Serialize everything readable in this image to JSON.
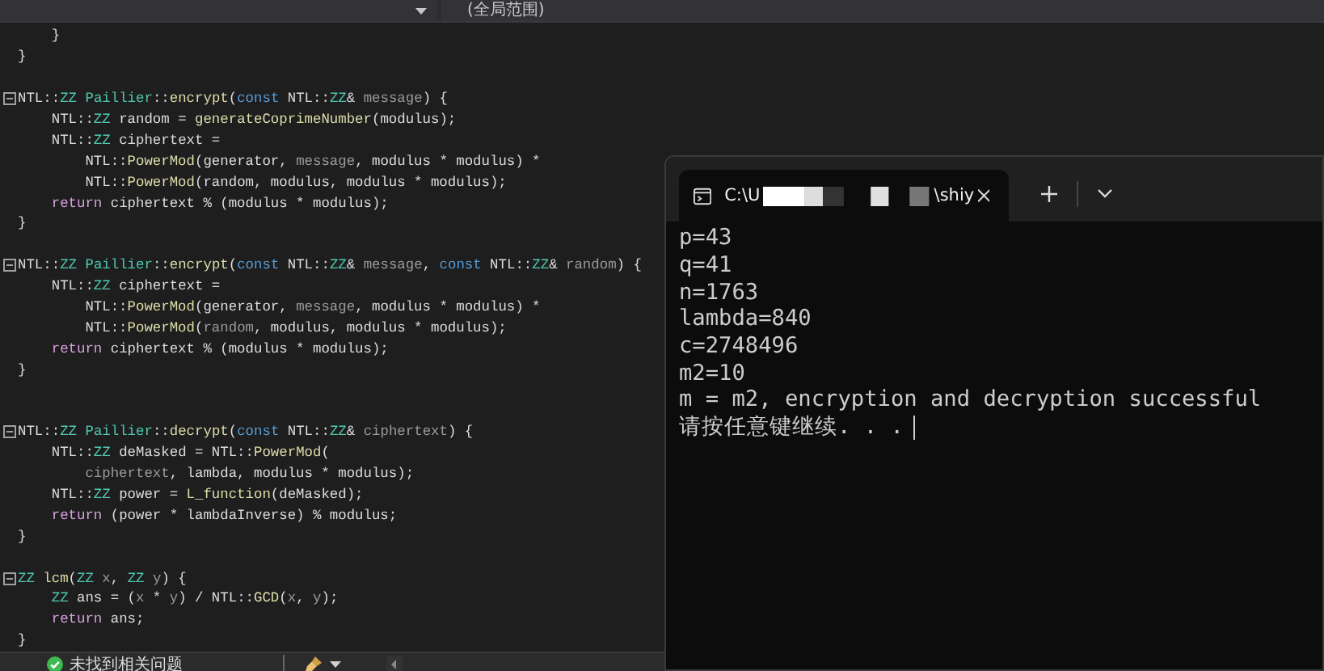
{
  "editor": {
    "scope_dropdown": {
      "value": "(全局范围)"
    },
    "lines": [
      {
        "kind": "code",
        "foldable": false,
        "segments": [
          {
            "kind": "plain",
            "text": "    }"
          }
        ]
      },
      {
        "kind": "code",
        "foldable": false,
        "segments": [
          {
            "kind": "plain",
            "text": "}"
          }
        ]
      },
      {
        "kind": "blank"
      },
      {
        "kind": "code",
        "foldable": true,
        "segments": [
          {
            "kind": "plain",
            "text": "NTL::"
          },
          {
            "kind": "type",
            "text": "ZZ"
          },
          {
            "kind": "type",
            "text": " Paillier"
          },
          {
            "kind": "plain",
            "text": "::"
          },
          {
            "kind": "func",
            "text": "encrypt"
          },
          {
            "kind": "plain",
            "text": "("
          },
          {
            "kind": "keyword",
            "text": "const"
          },
          {
            "kind": "plain",
            "text": " NTL::"
          },
          {
            "kind": "type",
            "text": "ZZ"
          },
          {
            "kind": "plain",
            "text": "& "
          },
          {
            "kind": "param",
            "text": "message"
          },
          {
            "kind": "plain",
            "text": ") {"
          }
        ]
      },
      {
        "kind": "code",
        "foldable": false,
        "segments": [
          {
            "kind": "plain",
            "text": "    NTL::"
          },
          {
            "kind": "type",
            "text": "ZZ"
          },
          {
            "kind": "plain",
            "text": " random = "
          },
          {
            "kind": "func",
            "text": "generateCoprimeNumber"
          },
          {
            "kind": "plain",
            "text": "(modulus);"
          }
        ]
      },
      {
        "kind": "code",
        "foldable": false,
        "segments": [
          {
            "kind": "plain",
            "text": "    NTL::"
          },
          {
            "kind": "type",
            "text": "ZZ"
          },
          {
            "kind": "plain",
            "text": " ciphertext ="
          }
        ]
      },
      {
        "kind": "code",
        "foldable": false,
        "segments": [
          {
            "kind": "plain",
            "text": "        NTL::"
          },
          {
            "kind": "func",
            "text": "PowerMod"
          },
          {
            "kind": "plain",
            "text": "(generator, "
          },
          {
            "kind": "param",
            "text": "message"
          },
          {
            "kind": "plain",
            "text": ", modulus * modulus) *"
          }
        ]
      },
      {
        "kind": "code",
        "foldable": false,
        "segments": [
          {
            "kind": "plain",
            "text": "        NTL::"
          },
          {
            "kind": "func",
            "text": "PowerMod"
          },
          {
            "kind": "plain",
            "text": "(random, modulus, modulus * modulus);"
          }
        ]
      },
      {
        "kind": "code",
        "foldable": false,
        "segments": [
          {
            "kind": "return",
            "text": "    return"
          },
          {
            "kind": "plain",
            "text": " ciphertext % (modulus * modulus);"
          }
        ]
      },
      {
        "kind": "code",
        "foldable": false,
        "segments": [
          {
            "kind": "plain",
            "text": "}"
          }
        ]
      },
      {
        "kind": "blank"
      },
      {
        "kind": "code",
        "foldable": true,
        "segments": [
          {
            "kind": "plain",
            "text": "NTL::"
          },
          {
            "kind": "type",
            "text": "ZZ"
          },
          {
            "kind": "type",
            "text": " Paillier"
          },
          {
            "kind": "plain",
            "text": "::"
          },
          {
            "kind": "func",
            "text": "encrypt"
          },
          {
            "kind": "plain",
            "text": "("
          },
          {
            "kind": "keyword",
            "text": "const"
          },
          {
            "kind": "plain",
            "text": " NTL::"
          },
          {
            "kind": "type",
            "text": "ZZ"
          },
          {
            "kind": "plain",
            "text": "& "
          },
          {
            "kind": "param",
            "text": "message"
          },
          {
            "kind": "plain",
            "text": ", "
          },
          {
            "kind": "keyword",
            "text": "const"
          },
          {
            "kind": "plain",
            "text": " NTL::"
          },
          {
            "kind": "type",
            "text": "ZZ"
          },
          {
            "kind": "plain",
            "text": "& "
          },
          {
            "kind": "param",
            "text": "random"
          },
          {
            "kind": "plain",
            "text": ") {"
          }
        ]
      },
      {
        "kind": "code",
        "foldable": false,
        "segments": [
          {
            "kind": "plain",
            "text": "    NTL::"
          },
          {
            "kind": "type",
            "text": "ZZ"
          },
          {
            "kind": "plain",
            "text": " ciphertext ="
          }
        ]
      },
      {
        "kind": "code",
        "foldable": false,
        "segments": [
          {
            "kind": "plain",
            "text": "        NTL::"
          },
          {
            "kind": "func",
            "text": "PowerMod"
          },
          {
            "kind": "plain",
            "text": "(generator, "
          },
          {
            "kind": "param",
            "text": "message"
          },
          {
            "kind": "plain",
            "text": ", modulus * modulus) *"
          }
        ]
      },
      {
        "kind": "code",
        "foldable": false,
        "segments": [
          {
            "kind": "plain",
            "text": "        NTL::"
          },
          {
            "kind": "func",
            "text": "PowerMod"
          },
          {
            "kind": "plain",
            "text": "("
          },
          {
            "kind": "param",
            "text": "random"
          },
          {
            "kind": "plain",
            "text": ", modulus, modulus * modulus);"
          }
        ]
      },
      {
        "kind": "code",
        "foldable": false,
        "segments": [
          {
            "kind": "return",
            "text": "    return"
          },
          {
            "kind": "plain",
            "text": " ciphertext % (modulus * modulus);"
          }
        ]
      },
      {
        "kind": "code",
        "foldable": false,
        "segments": [
          {
            "kind": "plain",
            "text": "}"
          }
        ]
      },
      {
        "kind": "blank"
      },
      {
        "kind": "blank"
      },
      {
        "kind": "code",
        "foldable": true,
        "segments": [
          {
            "kind": "plain",
            "text": "NTL::"
          },
          {
            "kind": "type",
            "text": "ZZ"
          },
          {
            "kind": "type",
            "text": " Paillier"
          },
          {
            "kind": "plain",
            "text": "::"
          },
          {
            "kind": "func",
            "text": "decrypt"
          },
          {
            "kind": "plain",
            "text": "("
          },
          {
            "kind": "keyword",
            "text": "const"
          },
          {
            "kind": "plain",
            "text": " NTL::"
          },
          {
            "kind": "type",
            "text": "ZZ"
          },
          {
            "kind": "plain",
            "text": "& "
          },
          {
            "kind": "param",
            "text": "ciphertext"
          },
          {
            "kind": "plain",
            "text": ") {"
          }
        ]
      },
      {
        "kind": "code",
        "foldable": false,
        "segments": [
          {
            "kind": "plain",
            "text": "    NTL::"
          },
          {
            "kind": "type",
            "text": "ZZ"
          },
          {
            "kind": "plain",
            "text": " deMasked = NTL::"
          },
          {
            "kind": "func",
            "text": "PowerMod"
          },
          {
            "kind": "plain",
            "text": "("
          }
        ]
      },
      {
        "kind": "code",
        "foldable": false,
        "segments": [
          {
            "kind": "param",
            "text": "        ciphertext"
          },
          {
            "kind": "plain",
            "text": ", lambda, modulus * modulus);"
          }
        ]
      },
      {
        "kind": "code",
        "foldable": false,
        "segments": [
          {
            "kind": "plain",
            "text": "    NTL::"
          },
          {
            "kind": "type",
            "text": "ZZ"
          },
          {
            "kind": "plain",
            "text": " power = "
          },
          {
            "kind": "func",
            "text": "L_function"
          },
          {
            "kind": "plain",
            "text": "(deMasked);"
          }
        ]
      },
      {
        "kind": "code",
        "foldable": false,
        "segments": [
          {
            "kind": "return",
            "text": "    return"
          },
          {
            "kind": "plain",
            "text": " (power * lambdaInverse) % modulus;"
          }
        ]
      },
      {
        "kind": "code",
        "foldable": false,
        "segments": [
          {
            "kind": "plain",
            "text": "}"
          }
        ]
      },
      {
        "kind": "blank"
      },
      {
        "kind": "code",
        "foldable": true,
        "segments": [
          {
            "kind": "type",
            "text": "ZZ"
          },
          {
            "kind": "func",
            "text": " lcm"
          },
          {
            "kind": "plain",
            "text": "("
          },
          {
            "kind": "type",
            "text": "ZZ"
          },
          {
            "kind": "param",
            "text": " x"
          },
          {
            "kind": "plain",
            "text": ", "
          },
          {
            "kind": "type",
            "text": "ZZ"
          },
          {
            "kind": "param",
            "text": " y"
          },
          {
            "kind": "plain",
            "text": ") {"
          }
        ]
      },
      {
        "kind": "code",
        "foldable": false,
        "segments": [
          {
            "kind": "type",
            "text": "    ZZ"
          },
          {
            "kind": "plain",
            "text": " ans = ("
          },
          {
            "kind": "param",
            "text": "x"
          },
          {
            "kind": "plain",
            "text": " * "
          },
          {
            "kind": "param",
            "text": "y"
          },
          {
            "kind": "plain",
            "text": ") / NTL::"
          },
          {
            "kind": "func",
            "text": "GCD"
          },
          {
            "kind": "plain",
            "text": "("
          },
          {
            "kind": "param",
            "text": "x"
          },
          {
            "kind": "plain",
            "text": ", "
          },
          {
            "kind": "param",
            "text": "y"
          },
          {
            "kind": "plain",
            "text": ");"
          }
        ]
      },
      {
        "kind": "code",
        "foldable": false,
        "segments": [
          {
            "kind": "return",
            "text": "    return"
          },
          {
            "kind": "plain",
            "text": " ans;"
          }
        ]
      },
      {
        "kind": "code",
        "foldable": false,
        "segments": [
          {
            "kind": "plain",
            "text": "}"
          }
        ]
      }
    ]
  },
  "status_bar": {
    "issues": "未找到相关问题"
  },
  "terminal": {
    "tab": {
      "title_start": "C:\\U",
      "title_end": "\\shiy",
      "selected": true
    },
    "output": [
      "p=43",
      "q=41",
      "n=1763",
      "lambda=840",
      "c=2748496",
      "m2=10",
      "m = m2, encryption and decryption successful",
      "请按任意键继续. . ."
    ]
  }
}
